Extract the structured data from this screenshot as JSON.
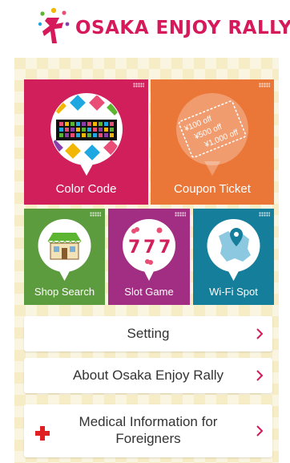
{
  "header": {
    "logo_text": "OSAKA ENJOY RALLY"
  },
  "tiles": {
    "color_code": {
      "label": "Color Code",
      "color": "#d01f5b"
    },
    "coupon_ticket": {
      "label": "Coupon Ticket",
      "color": "#ea7638",
      "coupon_values": [
        "¥100 off",
        "¥500 off",
        "¥1,000 off"
      ]
    },
    "shop_search": {
      "label": "Shop Search",
      "color": "#5c9c3e"
    },
    "slot_game": {
      "label": "Slot Game",
      "color": "#a12e82",
      "reel_digits": [
        "7",
        "7",
        "7"
      ]
    },
    "wifi_spot": {
      "label": "Wi-Fi Spot",
      "color": "#157e9a"
    }
  },
  "menu": {
    "setting": {
      "label": "Setting"
    },
    "about": {
      "label": "About Osaka Enjoy Rally"
    },
    "medical": {
      "label_line1": "Medical Information for",
      "label_line2": "Foreigners"
    }
  },
  "colors": {
    "brand": "#d6195a",
    "background": "#f6ecc6",
    "chevron": "#d6195a",
    "medical_cross": "#e02020"
  },
  "icons": [
    "logo-figure-icon",
    "color-code-icon",
    "coupon-ticket-icon",
    "shop-icon",
    "slot-machine-icon",
    "map-pin-icon",
    "medical-cross-icon",
    "chevron-right-icon"
  ]
}
